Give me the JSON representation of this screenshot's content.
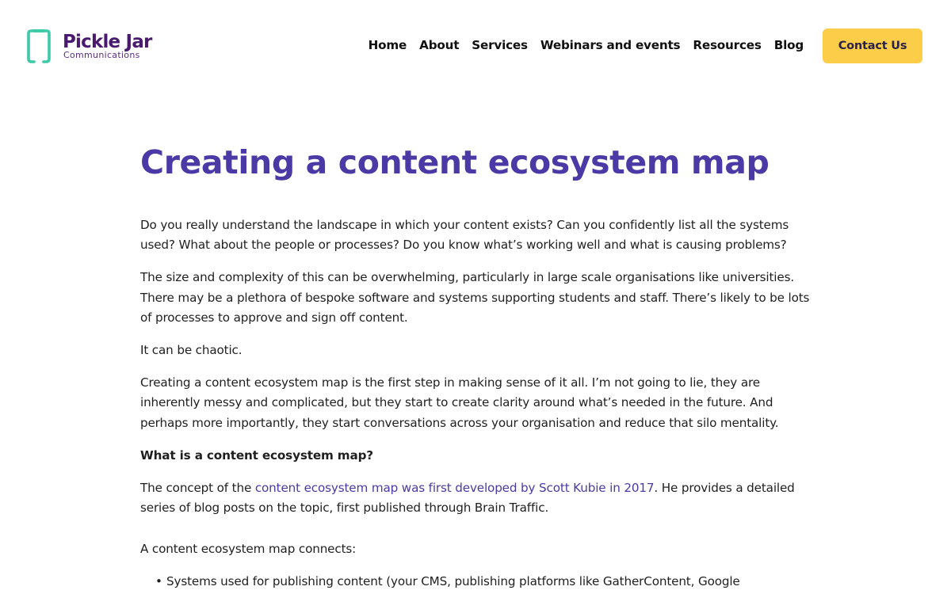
{
  "brand": {
    "name": "Pickle Jar",
    "tagline": "Communications",
    "mark_color": "#3ec9a7",
    "name_color": "#4a1a6e"
  },
  "nav": {
    "items": [
      {
        "label": "Home"
      },
      {
        "label": "About"
      },
      {
        "label": "Services"
      },
      {
        "label": "Webinars and events"
      },
      {
        "label": "Resources"
      },
      {
        "label": "Blog"
      }
    ],
    "cta_label": "Contact Us",
    "cta_color": "#fbcd48"
  },
  "article": {
    "title": "Creating a content ecosystem map",
    "title_color": "#4b3aa6",
    "paragraphs": [
      "Do you really understand the landscape in which your content exists? Can you confidently list all the systems used? What about the people or processes? Do you know what’s working well and what is causing problems?",
      "The size and complexity of this can be overwhelming, particularly in large scale organisations like universities. There may be a plethora of bespoke software and systems supporting students and staff. There’s likely to be lots of processes to approve and sign off content.",
      "It can be chaotic.",
      "Creating a content ecosystem map is the first step in making sense of it all. I’m not going to lie, they are inherently messy and complicated, but they start to create clarity around what’s needed in the future.  And perhaps more importantly, they start conversations across your organisation and reduce that silo mentality."
    ],
    "subheading": "What is a content ecosystem map?",
    "concept": {
      "before": "The concept of the ",
      "link_text": "content ecosystem map was first developed by Scott Kubie in 2017",
      "after": ".  He provides a detailed series of blog posts on the topic, first published through Brain Traffic."
    },
    "connects_intro": "A content ecosystem map connects:",
    "list_items": [
      "Systems used for publishing content (your CMS, publishing platforms like GatherContent, Google"
    ],
    "bullet": "•"
  }
}
